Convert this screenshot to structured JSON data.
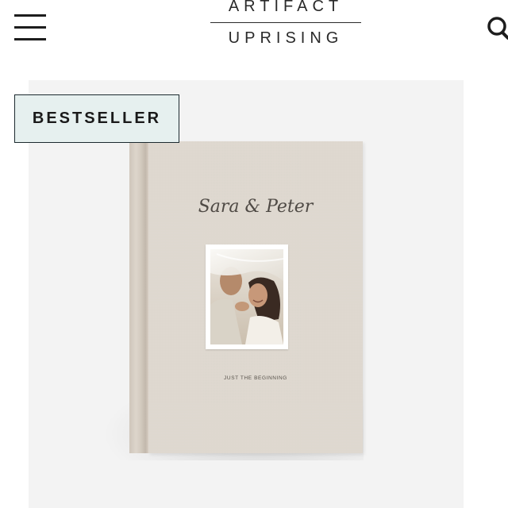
{
  "header": {
    "menu_icon": "hamburger-menu-icon",
    "logo": {
      "line1": "ARTIFACT",
      "line2": "UPRISING"
    },
    "search_icon": "search-icon"
  },
  "product": {
    "badge": "BESTSELLER",
    "book": {
      "title": "Sara & Peter",
      "tagline": "JUST THE BEGINNING"
    }
  },
  "colors": {
    "panel_bg": "#f3f3f3",
    "badge_bg": "#e6f0ef",
    "badge_border": "#1c2a2f",
    "book_cover": "#dfd8cf"
  }
}
